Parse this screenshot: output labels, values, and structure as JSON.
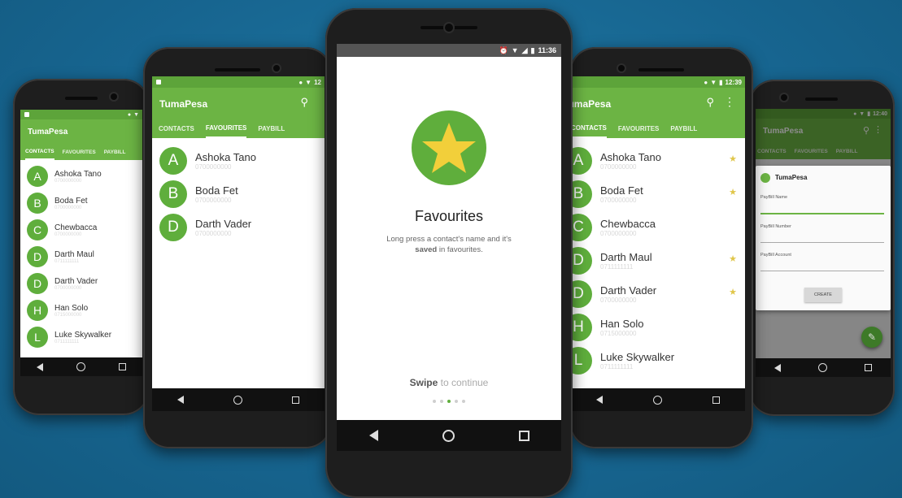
{
  "app_name": "TumaPesa",
  "tabs": {
    "contacts": "CONTACTS",
    "favourites": "FAVOURITES",
    "paybill": "PAYBILL"
  },
  "times": {
    "phone2": "12",
    "phone3": "11:36",
    "phone4": "12:39",
    "phone5": "12:40"
  },
  "contacts": [
    {
      "letter": "A",
      "name": "Ashoka Tano",
      "number": "0700000000"
    },
    {
      "letter": "B",
      "name": "Boda Fet",
      "number": "0700000000"
    },
    {
      "letter": "C",
      "name": "Chewbacca",
      "number": "0700000000"
    },
    {
      "letter": "D",
      "name": "Darth Maul",
      "number": "0711111111"
    },
    {
      "letter": "D",
      "name": "Darth Vader",
      "number": "0700000000"
    },
    {
      "letter": "H",
      "name": "Han Solo",
      "number": "0715000000"
    },
    {
      "letter": "L",
      "name": "Luke Skywalker",
      "number": "0711111111"
    }
  ],
  "favourites_list": [
    {
      "letter": "A",
      "name": "Ashoka Tano",
      "number": "0700000000"
    },
    {
      "letter": "B",
      "name": "Boda Fet",
      "number": "0700000000"
    },
    {
      "letter": "D",
      "name": "Darth Vader",
      "number": "0700000000"
    }
  ],
  "onboarding": {
    "title": "Favourites",
    "description_pre": "Long press a contact's name and it's",
    "description_bold": "saved",
    "description_post": " in favourites.",
    "swipe_bold": "Swipe",
    "swipe_rest": " to continue",
    "page_dots_total": 5,
    "page_dot_active": 3
  },
  "dialog": {
    "title": "TumaPesa",
    "field1_label": "PayBill Name",
    "field2_label": "PayBill Number",
    "field3_label": "PayBill Account",
    "create_button": "CREATE"
  },
  "colors": {
    "background": "#1b6d94",
    "primary": "#6cb444",
    "primary_dark": "#5da43a",
    "avatar": "#5fae3c",
    "star": "#e8c930"
  },
  "icons": [
    "search-icon",
    "more-vert-icon",
    "star-icon",
    "back-icon",
    "home-icon",
    "recents-icon",
    "edit-icon",
    "wifi-icon",
    "signal-icon",
    "battery-icon",
    "alarm-icon",
    "location-icon"
  ]
}
